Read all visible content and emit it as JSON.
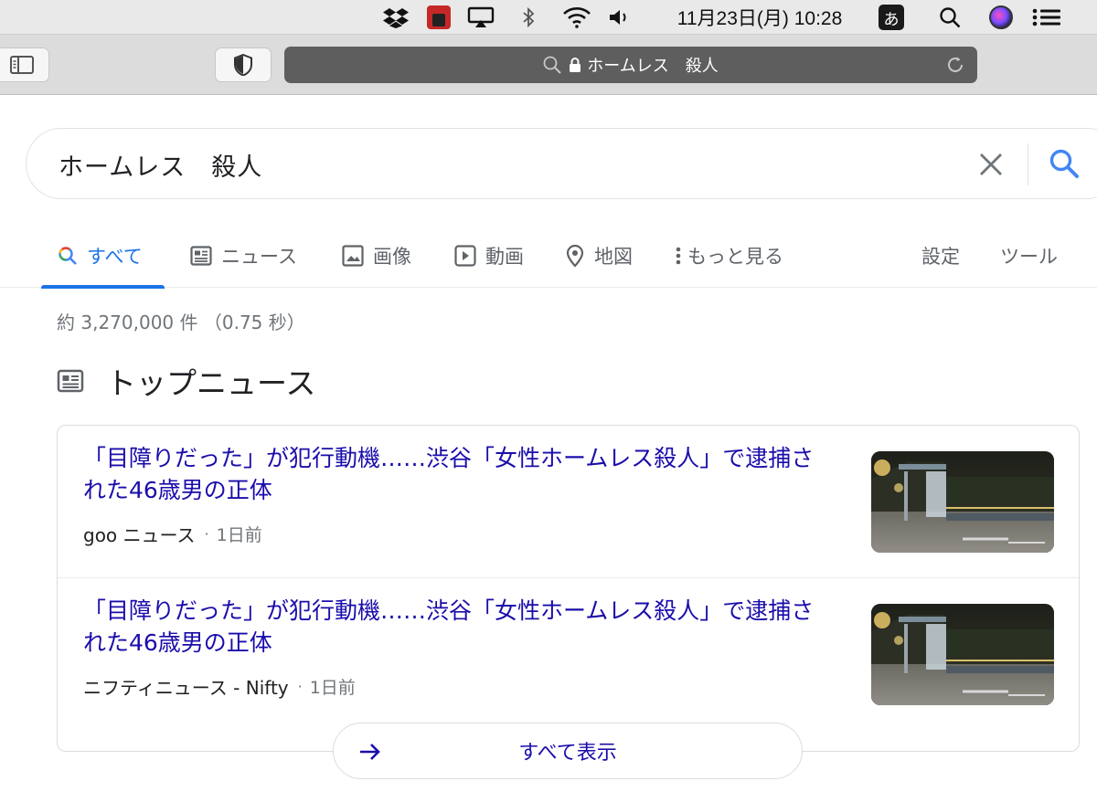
{
  "menubar": {
    "date_time": "11月23日(月)  10:28",
    "ime_label": "あ",
    "parallels_label": "Parallels"
  },
  "toolbar": {
    "address_text": "ホームレス　殺人"
  },
  "search": {
    "query": "ホームレス　殺人"
  },
  "tabs": {
    "all": "すべて",
    "news": "ニュース",
    "images": "画像",
    "videos": "動画",
    "maps": "地図",
    "more": "もっと見る",
    "settings": "設定",
    "tools": "ツール"
  },
  "results": {
    "stats": "約 3,270,000 件 （0.75 秒）"
  },
  "top_news": {
    "heading": "トップニュース",
    "items": [
      {
        "headline": "「目障りだった」が犯行動機……渋谷「女性ホームレス殺人」で逮捕された46歳男の正体",
        "source": "goo ニュース",
        "age": "1日前"
      },
      {
        "headline": "「目障りだった」が犯行動機……渋谷「女性ホームレス殺人」で逮捕された46歳男の正体",
        "source": "ニフティニュース - Nifty",
        "age": "1日前"
      }
    ],
    "more_label": "すべて表示"
  },
  "colors": {
    "link": "#1a0dab",
    "accent": "#1a73e8",
    "secondary_text": "#70757a"
  },
  "icons": [
    "dropbox-icon",
    "parallels-icon",
    "airplay-icon",
    "bluetooth-icon",
    "wifi-icon",
    "volume-icon",
    "spotlight-search-icon",
    "siri-icon",
    "notification-center-icon",
    "sidebar-icon",
    "privacy-shield-icon",
    "search-icon",
    "lock-icon",
    "reload-icon",
    "clear-icon",
    "google-search-icon",
    "newspaper-icon",
    "image-icon",
    "play-icon",
    "map-pin-icon",
    "more-dots-icon",
    "arrow-right-icon"
  ]
}
